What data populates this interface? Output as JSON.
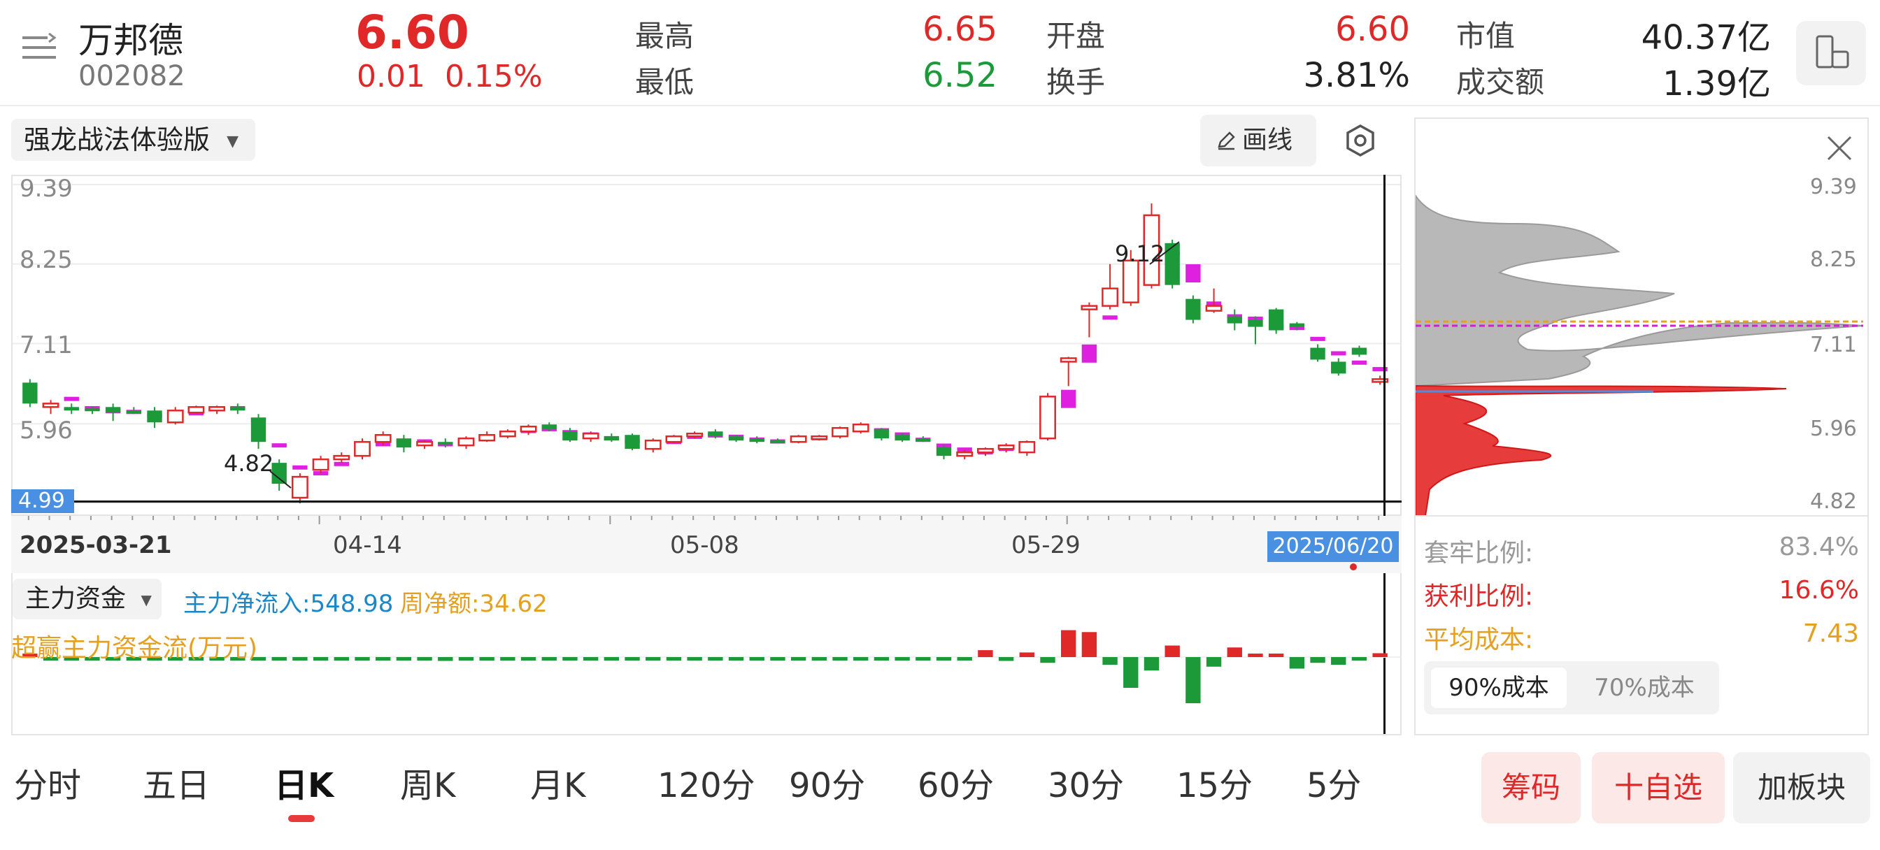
{
  "header": {
    "name": "万邦德",
    "code": "002082",
    "price": "6.60",
    "change": "0.01",
    "change_pct": "0.15%",
    "high_label": "最高",
    "high": "6.65",
    "low_label": "最低",
    "low": "6.52",
    "open_label": "开盘",
    "open": "6.60",
    "turnover_label": "换手",
    "turnover": "3.81%",
    "mcap_label": "市值",
    "mcap": "40.37亿",
    "amount_label": "成交额",
    "amount": "1.39亿"
  },
  "toolbar": {
    "indicator": "强龙战法体验版",
    "draw_label": "画线"
  },
  "chart": {
    "price_ticks": [
      "9.39",
      "8.25",
      "7.11",
      "5.96"
    ],
    "crosshair_price": "4.99",
    "peak_label": "9.12",
    "trough_label": "4.82",
    "date_labels": [
      "2025-03-21",
      "04-14",
      "05-08",
      "05-29"
    ],
    "cursor_date": "2025/06/20"
  },
  "cost": {
    "ticks": [
      "9.39",
      "8.25",
      "7.11",
      "5.96",
      "4.82"
    ],
    "trapped_label": "套牢比例:",
    "trapped_val": "83.4%",
    "profit_label": "获利比例:",
    "profit_val": "16.6%",
    "avg_label": "平均成本:",
    "avg_val": "7.43",
    "tab_90": "90%成本",
    "tab_70": "70%成本"
  },
  "moneyflow": {
    "selector": "主力资金",
    "net_inflow": "主力净流入:548.98",
    "weekly_net": "周净额:34.62",
    "subtitle": "超赢主力资金流(万元)"
  },
  "periods": [
    "分时",
    "五日",
    "日K",
    "周K",
    "月K",
    "120分",
    "90分",
    "60分",
    "30分",
    "15分",
    "5分"
  ],
  "actions": {
    "chips": "筹码",
    "watch": "十自选",
    "plate": "加板块"
  },
  "colors": {
    "up": "#e02828",
    "down": "#1c9a3a",
    "ma": "#e020e0",
    "cursor_bg": "#4a90e2"
  },
  "chart_data": {
    "type": "candlestick",
    "x_range": [
      "2025-03-21",
      "2025/06/20"
    ],
    "y_ticks": [
      9.39,
      8.25,
      7.11,
      5.96,
      4.82
    ],
    "ylim": [
      4.82,
      9.39
    ],
    "candles": [
      {
        "o": 6.25,
        "c": 6.55,
        "h": 6.6,
        "l": 6.2,
        "up": false
      },
      {
        "o": 6.2,
        "c": 6.25,
        "h": 6.3,
        "l": 6.1,
        "up": true
      },
      {
        "o": 6.2,
        "c": 6.15,
        "h": 6.25,
        "l": 6.1,
        "up": false
      },
      {
        "o": 6.18,
        "c": 6.15,
        "h": 6.2,
        "l": 6.1,
        "up": false
      },
      {
        "o": 6.2,
        "c": 6.12,
        "h": 6.25,
        "l": 6.0,
        "up": false
      },
      {
        "o": 6.15,
        "c": 6.12,
        "h": 6.2,
        "l": 6.1,
        "up": false
      },
      {
        "o": 6.15,
        "c": 5.98,
        "h": 6.2,
        "l": 5.9,
        "up": false
      },
      {
        "o": 5.98,
        "c": 6.15,
        "h": 6.2,
        "l": 5.95,
        "up": true
      },
      {
        "o": 6.12,
        "c": 6.2,
        "h": 6.22,
        "l": 6.1,
        "up": true
      },
      {
        "o": 6.15,
        "c": 6.2,
        "h": 6.22,
        "l": 6.1,
        "up": true
      },
      {
        "o": 6.2,
        "c": 6.15,
        "h": 6.25,
        "l": 6.1,
        "up": false
      },
      {
        "o": 6.05,
        "c": 5.7,
        "h": 6.1,
        "l": 5.6,
        "up": false
      },
      {
        "o": 5.4,
        "c": 5.1,
        "h": 5.45,
        "l": 5.0,
        "up": false
      },
      {
        "o": 4.9,
        "c": 5.2,
        "h": 5.25,
        "l": 4.82,
        "up": true
      },
      {
        "o": 5.3,
        "c": 5.45,
        "h": 5.5,
        "l": 5.25,
        "up": true
      },
      {
        "o": 5.45,
        "c": 5.5,
        "h": 5.55,
        "l": 5.4,
        "up": true
      },
      {
        "o": 5.5,
        "c": 5.7,
        "h": 5.75,
        "l": 5.45,
        "up": true
      },
      {
        "o": 5.7,
        "c": 5.8,
        "h": 5.85,
        "l": 5.65,
        "up": true
      },
      {
        "o": 5.75,
        "c": 5.62,
        "h": 5.8,
        "l": 5.55,
        "up": false
      },
      {
        "o": 5.65,
        "c": 5.7,
        "h": 5.72,
        "l": 5.6,
        "up": true
      },
      {
        "o": 5.7,
        "c": 5.68,
        "h": 5.75,
        "l": 5.62,
        "up": false
      },
      {
        "o": 5.65,
        "c": 5.75,
        "h": 5.78,
        "l": 5.6,
        "up": true
      },
      {
        "o": 5.72,
        "c": 5.8,
        "h": 5.85,
        "l": 5.7,
        "up": true
      },
      {
        "o": 5.78,
        "c": 5.85,
        "h": 5.88,
        "l": 5.75,
        "up": true
      },
      {
        "o": 5.85,
        "c": 5.92,
        "h": 5.95,
        "l": 5.8,
        "up": true
      },
      {
        "o": 5.95,
        "c": 5.88,
        "h": 5.98,
        "l": 5.85,
        "up": false
      },
      {
        "o": 5.85,
        "c": 5.72,
        "h": 5.9,
        "l": 5.7,
        "up": false
      },
      {
        "o": 5.75,
        "c": 5.82,
        "h": 5.85,
        "l": 5.7,
        "up": true
      },
      {
        "o": 5.78,
        "c": 5.72,
        "h": 5.82,
        "l": 5.7,
        "up": false
      },
      {
        "o": 5.8,
        "c": 5.6,
        "h": 5.82,
        "l": 5.58,
        "up": false
      },
      {
        "o": 5.6,
        "c": 5.72,
        "h": 5.75,
        "l": 5.55,
        "up": true
      },
      {
        "o": 5.7,
        "c": 5.78,
        "h": 5.8,
        "l": 5.68,
        "up": true
      },
      {
        "o": 5.78,
        "c": 5.82,
        "h": 5.85,
        "l": 5.75,
        "up": true
      },
      {
        "o": 5.85,
        "c": 5.78,
        "h": 5.88,
        "l": 5.75,
        "up": false
      },
      {
        "o": 5.78,
        "c": 5.72,
        "h": 5.8,
        "l": 5.7,
        "up": false
      },
      {
        "o": 5.75,
        "c": 5.7,
        "h": 5.78,
        "l": 5.68,
        "up": false
      },
      {
        "o": 5.72,
        "c": 5.7,
        "h": 5.75,
        "l": 5.68,
        "up": false
      },
      {
        "o": 5.7,
        "c": 5.78,
        "h": 5.8,
        "l": 5.68,
        "up": true
      },
      {
        "o": 5.75,
        "c": 5.78,
        "h": 5.8,
        "l": 5.72,
        "up": true
      },
      {
        "o": 5.78,
        "c": 5.9,
        "h": 5.92,
        "l": 5.75,
        "up": true
      },
      {
        "o": 5.85,
        "c": 5.95,
        "h": 5.98,
        "l": 5.82,
        "up": true
      },
      {
        "o": 5.88,
        "c": 5.75,
        "h": 5.9,
        "l": 5.72,
        "up": false
      },
      {
        "o": 5.8,
        "c": 5.72,
        "h": 5.82,
        "l": 5.7,
        "up": false
      },
      {
        "o": 5.75,
        "c": 5.72,
        "h": 5.78,
        "l": 5.7,
        "up": false
      },
      {
        "o": 5.62,
        "c": 5.5,
        "h": 5.65,
        "l": 5.45,
        "up": false
      },
      {
        "o": 5.5,
        "c": 5.55,
        "h": 5.58,
        "l": 5.45,
        "up": true
      },
      {
        "o": 5.55,
        "c": 5.6,
        "h": 5.62,
        "l": 5.5,
        "up": true
      },
      {
        "o": 5.6,
        "c": 5.65,
        "h": 5.68,
        "l": 5.55,
        "up": true
      },
      {
        "o": 5.55,
        "c": 5.7,
        "h": 5.72,
        "l": 5.5,
        "up": true
      },
      {
        "o": 5.75,
        "c": 6.35,
        "h": 6.4,
        "l": 5.72,
        "up": true
      },
      {
        "o": 6.85,
        "c": 6.9,
        "h": 6.92,
        "l": 6.5,
        "up": true
      },
      {
        "o": 7.6,
        "c": 7.65,
        "h": 7.7,
        "l": 7.2,
        "up": true
      },
      {
        "o": 7.65,
        "c": 7.9,
        "h": 8.25,
        "l": 7.6,
        "up": true
      },
      {
        "o": 7.7,
        "c": 8.3,
        "h": 8.45,
        "l": 7.65,
        "up": true
      },
      {
        "o": 7.95,
        "c": 8.95,
        "h": 9.12,
        "l": 7.9,
        "up": true
      },
      {
        "o": 8.55,
        "c": 7.95,
        "h": 8.6,
        "l": 7.9,
        "up": false
      },
      {
        "o": 7.75,
        "c": 7.45,
        "h": 7.8,
        "l": 7.4,
        "up": false
      },
      {
        "o": 7.58,
        "c": 7.65,
        "h": 7.9,
        "l": 7.55,
        "up": true
      },
      {
        "o": 7.5,
        "c": 7.4,
        "h": 7.6,
        "l": 7.3,
        "up": false
      },
      {
        "o": 7.45,
        "c": 7.35,
        "h": 7.5,
        "l": 7.1,
        "up": false
      },
      {
        "o": 7.6,
        "c": 7.3,
        "h": 7.62,
        "l": 7.25,
        "up": false
      },
      {
        "o": 7.4,
        "c": 7.35,
        "h": 7.42,
        "l": 7.3,
        "up": false
      },
      {
        "o": 7.05,
        "c": 6.88,
        "h": 7.1,
        "l": 6.85,
        "up": false
      },
      {
        "o": 6.85,
        "c": 6.68,
        "h": 6.9,
        "l": 6.65,
        "up": false
      },
      {
        "o": 7.05,
        "c": 6.95,
        "h": 7.08,
        "l": 6.92,
        "up": false
      },
      {
        "o": 6.6,
        "c": 6.6,
        "h": 6.65,
        "l": 6.52,
        "up": true
      }
    ],
    "flow": [
      5,
      -4,
      -6,
      -5,
      -4,
      -4,
      -5,
      -4,
      -4,
      -5,
      -3,
      -3,
      -3,
      -3,
      -3,
      -3,
      -3,
      -3,
      -3,
      -3,
      -10,
      -5,
      -4,
      -3,
      -3,
      -3,
      -3,
      -3,
      -3,
      -3,
      -3,
      -3,
      -4,
      -5,
      -4,
      -5,
      -4,
      -3,
      -3,
      -3,
      -3,
      -3,
      -3,
      -3,
      -3,
      -3,
      18,
      -10,
      12,
      -15,
      70,
      65,
      -20,
      -80,
      -35,
      30,
      -120,
      -25,
      25,
      8,
      8,
      -30,
      -15,
      -20,
      -8,
      10
    ],
    "legend": [
      "主力净流入:548.98",
      "周净额:34.62"
    ]
  }
}
